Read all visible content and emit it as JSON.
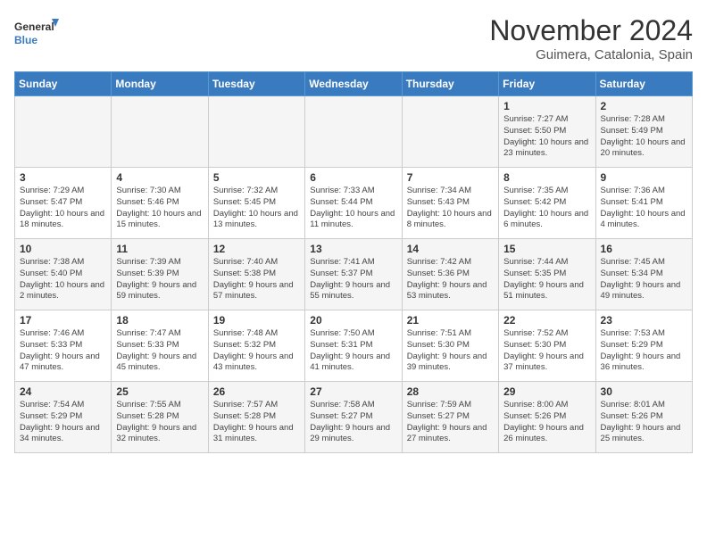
{
  "logo": {
    "line1": "General",
    "line2": "Blue"
  },
  "title": "November 2024",
  "location": "Guimera, Catalonia, Spain",
  "weekdays": [
    "Sunday",
    "Monday",
    "Tuesday",
    "Wednesday",
    "Thursday",
    "Friday",
    "Saturday"
  ],
  "weeks": [
    [
      {
        "day": "",
        "info": ""
      },
      {
        "day": "",
        "info": ""
      },
      {
        "day": "",
        "info": ""
      },
      {
        "day": "",
        "info": ""
      },
      {
        "day": "",
        "info": ""
      },
      {
        "day": "1",
        "info": "Sunrise: 7:27 AM\nSunset: 5:50 PM\nDaylight: 10 hours and 23 minutes."
      },
      {
        "day": "2",
        "info": "Sunrise: 7:28 AM\nSunset: 5:49 PM\nDaylight: 10 hours and 20 minutes."
      }
    ],
    [
      {
        "day": "3",
        "info": "Sunrise: 7:29 AM\nSunset: 5:47 PM\nDaylight: 10 hours and 18 minutes."
      },
      {
        "day": "4",
        "info": "Sunrise: 7:30 AM\nSunset: 5:46 PM\nDaylight: 10 hours and 15 minutes."
      },
      {
        "day": "5",
        "info": "Sunrise: 7:32 AM\nSunset: 5:45 PM\nDaylight: 10 hours and 13 minutes."
      },
      {
        "day": "6",
        "info": "Sunrise: 7:33 AM\nSunset: 5:44 PM\nDaylight: 10 hours and 11 minutes."
      },
      {
        "day": "7",
        "info": "Sunrise: 7:34 AM\nSunset: 5:43 PM\nDaylight: 10 hours and 8 minutes."
      },
      {
        "day": "8",
        "info": "Sunrise: 7:35 AM\nSunset: 5:42 PM\nDaylight: 10 hours and 6 minutes."
      },
      {
        "day": "9",
        "info": "Sunrise: 7:36 AM\nSunset: 5:41 PM\nDaylight: 10 hours and 4 minutes."
      }
    ],
    [
      {
        "day": "10",
        "info": "Sunrise: 7:38 AM\nSunset: 5:40 PM\nDaylight: 10 hours and 2 minutes."
      },
      {
        "day": "11",
        "info": "Sunrise: 7:39 AM\nSunset: 5:39 PM\nDaylight: 9 hours and 59 minutes."
      },
      {
        "day": "12",
        "info": "Sunrise: 7:40 AM\nSunset: 5:38 PM\nDaylight: 9 hours and 57 minutes."
      },
      {
        "day": "13",
        "info": "Sunrise: 7:41 AM\nSunset: 5:37 PM\nDaylight: 9 hours and 55 minutes."
      },
      {
        "day": "14",
        "info": "Sunrise: 7:42 AM\nSunset: 5:36 PM\nDaylight: 9 hours and 53 minutes."
      },
      {
        "day": "15",
        "info": "Sunrise: 7:44 AM\nSunset: 5:35 PM\nDaylight: 9 hours and 51 minutes."
      },
      {
        "day": "16",
        "info": "Sunrise: 7:45 AM\nSunset: 5:34 PM\nDaylight: 9 hours and 49 minutes."
      }
    ],
    [
      {
        "day": "17",
        "info": "Sunrise: 7:46 AM\nSunset: 5:33 PM\nDaylight: 9 hours and 47 minutes."
      },
      {
        "day": "18",
        "info": "Sunrise: 7:47 AM\nSunset: 5:33 PM\nDaylight: 9 hours and 45 minutes."
      },
      {
        "day": "19",
        "info": "Sunrise: 7:48 AM\nSunset: 5:32 PM\nDaylight: 9 hours and 43 minutes."
      },
      {
        "day": "20",
        "info": "Sunrise: 7:50 AM\nSunset: 5:31 PM\nDaylight: 9 hours and 41 minutes."
      },
      {
        "day": "21",
        "info": "Sunrise: 7:51 AM\nSunset: 5:30 PM\nDaylight: 9 hours and 39 minutes."
      },
      {
        "day": "22",
        "info": "Sunrise: 7:52 AM\nSunset: 5:30 PM\nDaylight: 9 hours and 37 minutes."
      },
      {
        "day": "23",
        "info": "Sunrise: 7:53 AM\nSunset: 5:29 PM\nDaylight: 9 hours and 36 minutes."
      }
    ],
    [
      {
        "day": "24",
        "info": "Sunrise: 7:54 AM\nSunset: 5:29 PM\nDaylight: 9 hours and 34 minutes."
      },
      {
        "day": "25",
        "info": "Sunrise: 7:55 AM\nSunset: 5:28 PM\nDaylight: 9 hours and 32 minutes."
      },
      {
        "day": "26",
        "info": "Sunrise: 7:57 AM\nSunset: 5:28 PM\nDaylight: 9 hours and 31 minutes."
      },
      {
        "day": "27",
        "info": "Sunrise: 7:58 AM\nSunset: 5:27 PM\nDaylight: 9 hours and 29 minutes."
      },
      {
        "day": "28",
        "info": "Sunrise: 7:59 AM\nSunset: 5:27 PM\nDaylight: 9 hours and 27 minutes."
      },
      {
        "day": "29",
        "info": "Sunrise: 8:00 AM\nSunset: 5:26 PM\nDaylight: 9 hours and 26 minutes."
      },
      {
        "day": "30",
        "info": "Sunrise: 8:01 AM\nSunset: 5:26 PM\nDaylight: 9 hours and 25 minutes."
      }
    ]
  ]
}
